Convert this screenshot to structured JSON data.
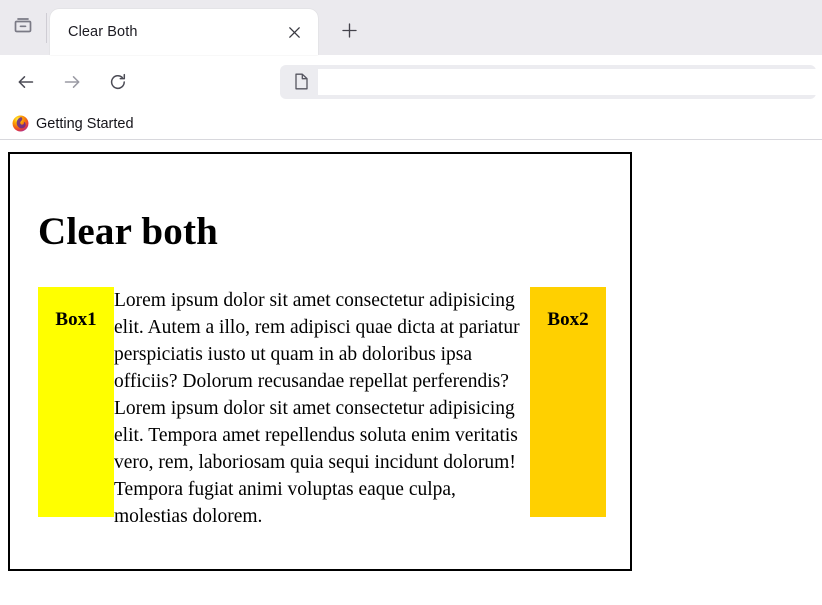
{
  "browser": {
    "tab_list_icon": "tab-box-icon",
    "tab": {
      "title": "Clear Both",
      "close_icon": "close-icon"
    },
    "new_tab_icon": "plus-icon",
    "nav": {
      "back_icon": "arrow-left-icon",
      "forward_icon": "arrow-right-icon",
      "reload_icon": "reload-icon"
    },
    "urlbar": {
      "page_icon": "document-icon",
      "value": "",
      "placeholder": ""
    },
    "bookmarks": [
      {
        "label": "Getting Started",
        "icon": "firefox-logo-icon"
      }
    ]
  },
  "page": {
    "heading": "Clear both",
    "box1": {
      "label": "Box1",
      "color": "#ffff00"
    },
    "box2": {
      "label": "Box2",
      "color": "#ffd000"
    },
    "paragraph": "Lorem ipsum dolor sit amet consectetur adipisicing elit. Autem a illo, rem adipisci quae dicta at pariatur perspiciatis iusto ut quam in ab doloribus ipsa officiis? Dolorum recusandae repellat perferendis? Lorem ipsum dolor sit amet consectetur adipisicing elit. Tempora amet repellendus soluta enim veritatis vero, rem, laboriosam quia sequi incidunt dolorum! Tempora fugiat animi voluptas eaque culpa, molestias dolorem."
  }
}
